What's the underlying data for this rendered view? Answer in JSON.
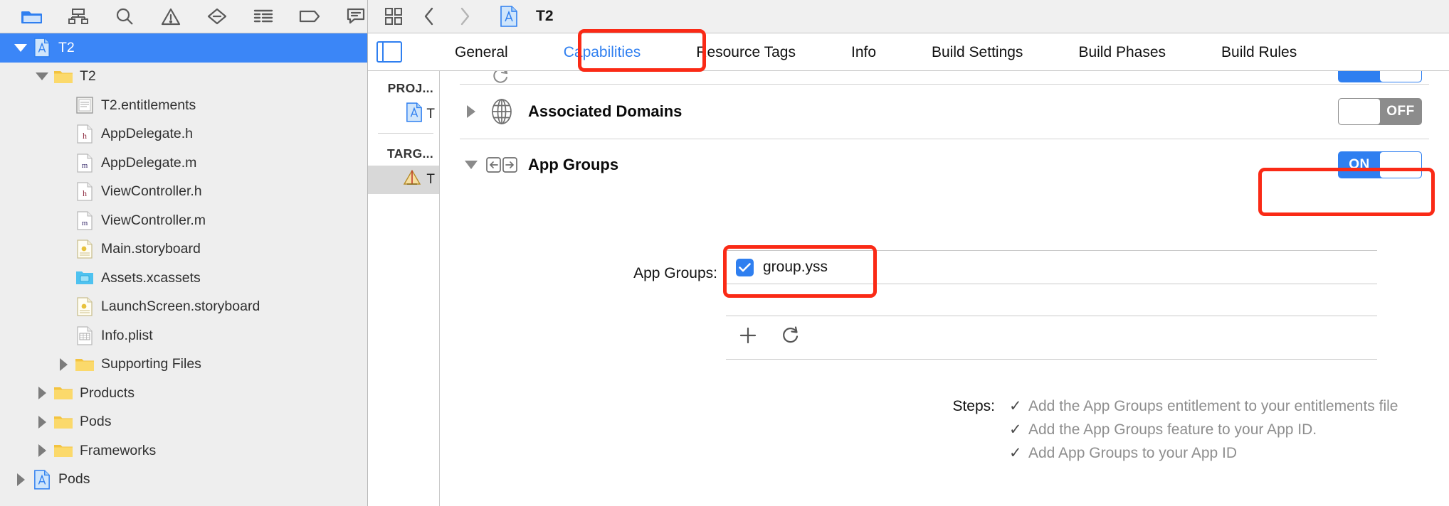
{
  "navigator": {
    "toolbar_icons": [
      {
        "name": "folder-icon",
        "label": "Project navigator"
      },
      {
        "name": "hierarchy-icon",
        "label": "Symbol navigator"
      },
      {
        "name": "search-icon",
        "label": "Find navigator"
      },
      {
        "name": "warning-triangle-icon",
        "label": "Issue navigator"
      },
      {
        "name": "test-diamond-icon",
        "label": "Test navigator"
      },
      {
        "name": "debug-list-icon",
        "label": "Debug navigator"
      },
      {
        "name": "breakpoint-tag-icon",
        "label": "Breakpoint navigator"
      },
      {
        "name": "report-bubble-icon",
        "label": "Report navigator"
      }
    ],
    "tree": [
      {
        "label": "T2",
        "indent": 0,
        "twisty": "down",
        "icon": "xcode-project-icon",
        "selected": true
      },
      {
        "label": "T2",
        "indent": 1,
        "twisty": "down",
        "icon": "folder-yellow-icon",
        "selected": false
      },
      {
        "label": "T2.entitlements",
        "indent": 2,
        "twisty": "none",
        "icon": "entitlements-icon",
        "selected": false
      },
      {
        "label": "AppDelegate.h",
        "indent": 2,
        "twisty": "none",
        "icon": "header-file-icon",
        "selected": false
      },
      {
        "label": "AppDelegate.m",
        "indent": 2,
        "twisty": "none",
        "icon": "objc-file-icon",
        "selected": false
      },
      {
        "label": "ViewController.h",
        "indent": 2,
        "twisty": "none",
        "icon": "header-file-icon",
        "selected": false
      },
      {
        "label": "ViewController.m",
        "indent": 2,
        "twisty": "none",
        "icon": "objc-file-icon",
        "selected": false
      },
      {
        "label": "Main.storyboard",
        "indent": 2,
        "twisty": "none",
        "icon": "storyboard-icon",
        "selected": false
      },
      {
        "label": "Assets.xcassets",
        "indent": 2,
        "twisty": "none",
        "icon": "xcassets-icon",
        "selected": false
      },
      {
        "label": "LaunchScreen.storyboard",
        "indent": 2,
        "twisty": "none",
        "icon": "storyboard-icon",
        "selected": false
      },
      {
        "label": "Info.plist",
        "indent": 2,
        "twisty": "none",
        "icon": "plist-icon",
        "selected": false
      },
      {
        "label": "Supporting Files",
        "indent": 2,
        "twisty": "right",
        "icon": "folder-yellow-icon",
        "selected": false
      },
      {
        "label": "Products",
        "indent": 1,
        "twisty": "right",
        "icon": "folder-yellow-icon",
        "selected": false
      },
      {
        "label": "Pods",
        "indent": 1,
        "twisty": "right",
        "icon": "folder-yellow-icon",
        "selected": false
      },
      {
        "label": "Frameworks",
        "indent": 1,
        "twisty": "right",
        "icon": "folder-yellow-icon",
        "selected": false
      },
      {
        "label": "Pods",
        "indent": 0,
        "twisty": "right",
        "icon": "xcode-project-icon",
        "selected": false
      }
    ]
  },
  "editor_toolbar": {
    "grid_icon": "editor-layout-icon",
    "back_icon": "chevron-left-icon",
    "forward_icon": "chevron-right-icon",
    "doc_icon": "xcode-project-icon",
    "title": "T2"
  },
  "tabs": [
    {
      "label": "General",
      "active": false
    },
    {
      "label": "Capabilities",
      "active": true
    },
    {
      "label": "Resource Tags",
      "active": false
    },
    {
      "label": "Info",
      "active": false
    },
    {
      "label": "Build Settings",
      "active": false
    },
    {
      "label": "Build Phases",
      "active": false
    },
    {
      "label": "Build Rules",
      "active": false
    }
  ],
  "project_column": {
    "project_header": "PROJ...",
    "project_items": [
      {
        "label": "T",
        "icon": "xcode-project-icon",
        "selected": false
      }
    ],
    "targets_header": "TARG...",
    "target_items": [
      {
        "label": "T",
        "icon": "app-target-icon",
        "selected": true
      }
    ]
  },
  "capabilities": {
    "associated_domains": {
      "title": "Associated Domains",
      "icon": "globe-icon",
      "expanded": false,
      "switch_label": "OFF",
      "switch_on": false
    },
    "app_groups": {
      "title": "App Groups",
      "icon": "app-groups-arrows-icon",
      "expanded": true,
      "switch_label": "ON",
      "switch_on": true,
      "field_label": "App Groups:",
      "entries": [
        {
          "text": "group.yss",
          "checked": true
        }
      ],
      "tools": [
        {
          "name": "add-group-button",
          "glyph": "+"
        },
        {
          "name": "refresh-groups-button",
          "glyph": "refresh"
        }
      ],
      "steps_label": "Steps:",
      "steps": [
        {
          "check": "✓",
          "text": "Add the App Groups entitlement to your entitlements file"
        },
        {
          "check": "✓",
          "text": "Add the App Groups feature to your App ID."
        },
        {
          "check": "✓",
          "text": "Add App Groups to your App ID"
        }
      ]
    }
  },
  "colors": {
    "accent_blue": "#2f7ff0",
    "selection_blue": "#3b86f7",
    "highlight_red": "#fa2a16",
    "switch_off_gray": "#8c8c8c",
    "folder_yellow": "#f7ce55"
  },
  "annotations": [
    {
      "name": "capabilities-tab-highlight"
    },
    {
      "name": "app-groups-switch-highlight"
    },
    {
      "name": "group-yss-checkbox-highlight"
    }
  ]
}
